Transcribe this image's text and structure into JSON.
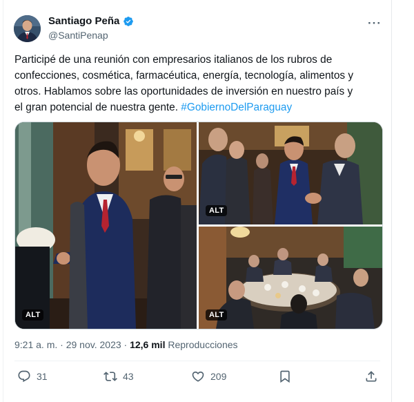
{
  "author": {
    "display_name": "Santiago Peña",
    "handle": "@SantiPenap",
    "verified": true
  },
  "tweet": {
    "lines": [
      "Participé de una reunión con empresarios italianos de los rubros de",
      "confecciones, cosmética, farmacéutica, energía, tecnología, alimentos y",
      "otros. Hablamos sobre las oportunidades de inversión en nuestro país y",
      "el gran potencial de nuestra gente. "
    ],
    "hashtag": "#GobiernoDelParaguay"
  },
  "media": {
    "alt_label": "ALT",
    "photo_count": 3
  },
  "meta": {
    "time": "9:21 a. m.",
    "separator": " · ",
    "date": "29 nov. 2023",
    "views_count": "12,6 mil",
    "views_label": "Reproducciones"
  },
  "actions": {
    "replies": "31",
    "reposts": "43",
    "likes": "209"
  },
  "colors": {
    "accent": "#1d9bf0",
    "secondary_text": "#536471",
    "primary_text": "#0f1419"
  },
  "icons": [
    "verified-badge-icon",
    "more-icon",
    "reply-icon",
    "repost-icon",
    "like-icon",
    "bookmark-icon",
    "share-icon"
  ]
}
